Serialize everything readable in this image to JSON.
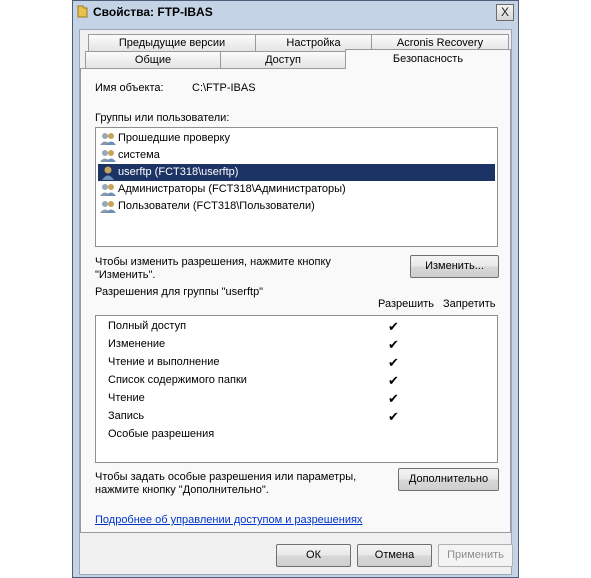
{
  "window": {
    "title": "Свойства: FTP-IBAS",
    "close_label": "X"
  },
  "tabs": {
    "row1": [
      "Предыдущие версии",
      "Настройка",
      "Acronis Recovery"
    ],
    "row2": [
      "Общие",
      "Доступ",
      "Безопасность"
    ],
    "active": "Безопасность"
  },
  "object": {
    "label": "Имя объекта:",
    "value": "C:\\FTP-IBAS"
  },
  "groups": {
    "label": "Группы или пользователи:",
    "items": [
      {
        "name": "Прошедшие проверку",
        "selected": false
      },
      {
        "name": "система",
        "selected": false
      },
      {
        "name": "userftp (FCT318\\userftp)",
        "selected": true
      },
      {
        "name": "Администраторы (FCT318\\Администраторы)",
        "selected": false
      },
      {
        "name": "Пользователи (FCT318\\Пользователи)",
        "selected": false
      }
    ]
  },
  "change": {
    "hint_line1": "Чтобы изменить разрешения, нажмите кнопку",
    "hint_line2": "\"Изменить\".",
    "button": "Изменить..."
  },
  "permissions": {
    "label": "Разрешения для группы \"userftp\"",
    "allow_header": "Разрешить",
    "deny_header": "Запретить",
    "rows": [
      {
        "name": "Полный доступ",
        "allow": true,
        "deny": false
      },
      {
        "name": "Изменение",
        "allow": true,
        "deny": false
      },
      {
        "name": "Чтение и выполнение",
        "allow": true,
        "deny": false
      },
      {
        "name": "Список содержимого папки",
        "allow": true,
        "deny": false
      },
      {
        "name": "Чтение",
        "allow": true,
        "deny": false
      },
      {
        "name": "Запись",
        "allow": true,
        "deny": false
      },
      {
        "name": "Особые разрешения",
        "allow": false,
        "deny": false
      }
    ],
    "check_glyph": "✔"
  },
  "advanced": {
    "hint_line1": "Чтобы задать особые разрешения или параметры,",
    "hint_line2": "нажмите кнопку \"Дополнительно\".",
    "button": "Дополнительно"
  },
  "help_link": "Подробнее об управлении доступом и разрешениях",
  "footer": {
    "ok": "ОК",
    "cancel": "Отмена",
    "apply": "Применить"
  }
}
